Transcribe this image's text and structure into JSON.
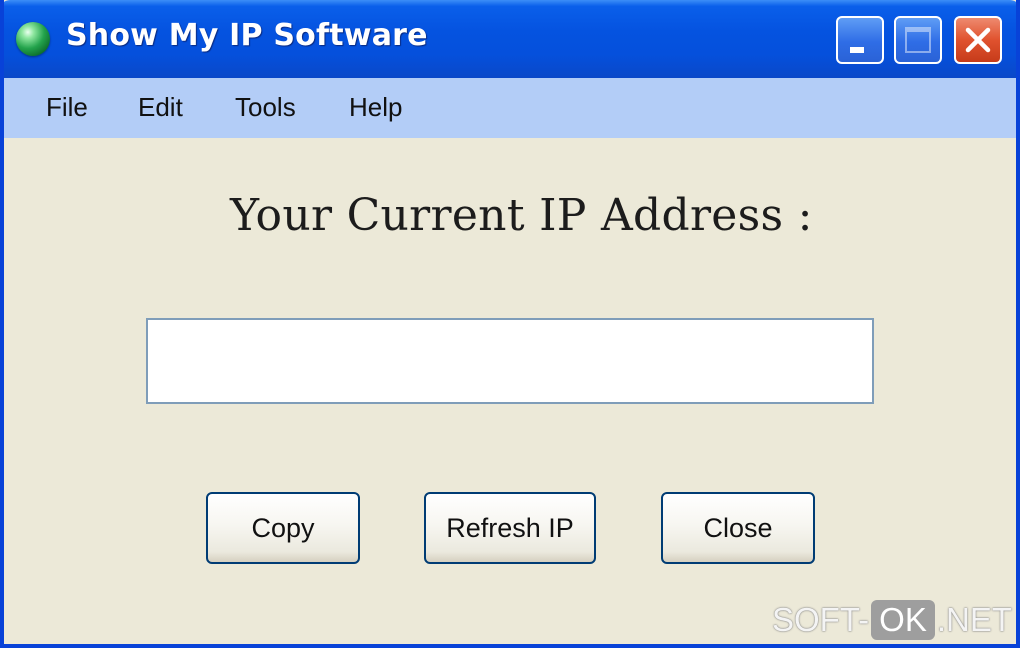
{
  "window": {
    "title": "Show My IP Software",
    "app_icon": "globe-icon",
    "controls": {
      "minimize_icon": "minimize-icon",
      "maximize_icon": "maximize-icon",
      "close_icon": "close-icon"
    }
  },
  "menu": {
    "items": [
      "File",
      "Edit",
      "Tools",
      "Help"
    ]
  },
  "main": {
    "heading": "Your Current IP Address :",
    "ip_value": ""
  },
  "buttons": {
    "copy": "Copy",
    "refresh": "Refresh IP",
    "close": "Close"
  },
  "watermark": {
    "left": "SOFT-",
    "middle": "OK",
    "right": ".NET"
  },
  "colors": {
    "titlebar": "#0553e0",
    "menubar": "#b3cdf7",
    "window_bg": "#ece9d8",
    "close_button": "#e0522e"
  }
}
